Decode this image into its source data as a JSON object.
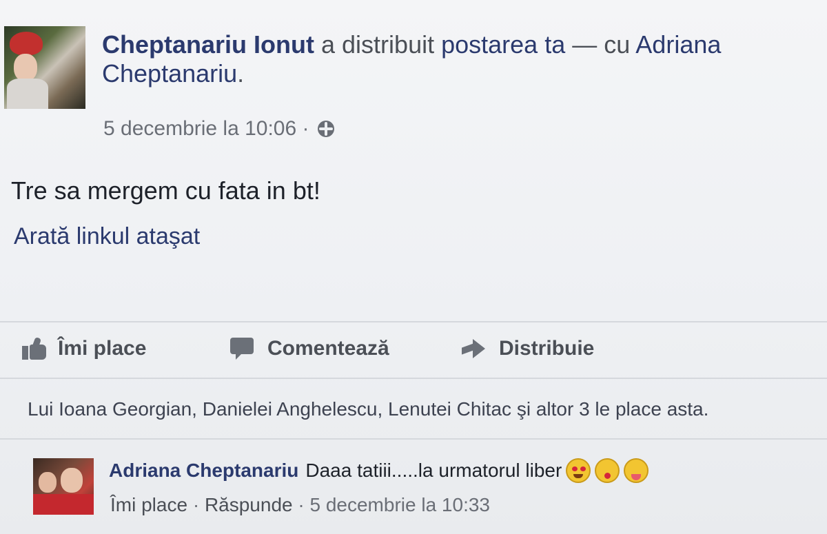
{
  "post": {
    "author": "Cheptanariu Ionut",
    "action_text": "a distribuit",
    "target_link": "postarea ta",
    "with_text": "— cu",
    "tagged_first": "Adriana",
    "tagged_last": "Cheptanariu",
    "tagged_period": ".",
    "timestamp": "5 decembrie la 10:06",
    "separator": "·",
    "privacy_icon": "globe-icon",
    "message": "Tre sa mergem cu fata in bt!",
    "attached_link_label": "Arată linkul ataşat"
  },
  "actions": {
    "like": "Îmi place",
    "comment": "Comentează",
    "share": "Distribuie"
  },
  "likes_summary": "Lui Ioana Georgian, Danielei Anghelescu, Lenutei Chitac şi altor 3 le place asta.",
  "comment": {
    "author": "Adriana Cheptanariu",
    "text": "Daaa tatiii.....la urmatorul liber",
    "emojis": [
      "heart-eyes-emoji",
      "kiss-emoji",
      "wink-tongue-emoji"
    ],
    "like_action": "Îmi place",
    "reply_action": "Răspunde",
    "separator": "·",
    "timestamp": "5 decembrie la 10:33"
  },
  "colors": {
    "link": "#2b3a6e",
    "meta": "#6a6e76",
    "background": "#eef0f3"
  }
}
